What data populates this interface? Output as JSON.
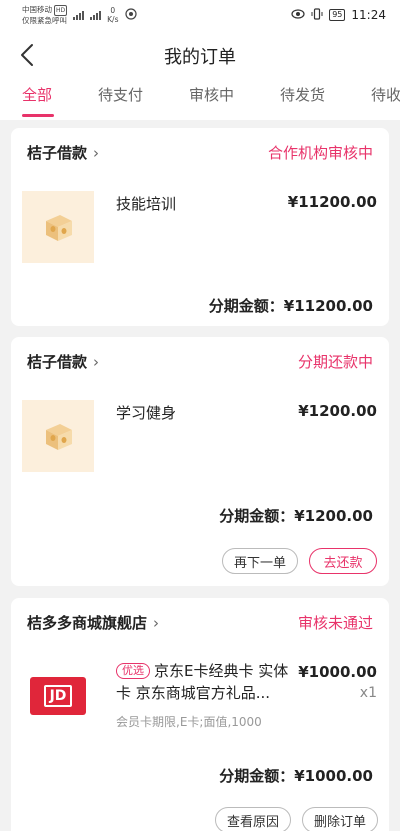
{
  "status_bar": {
    "carrier_line1": "中国移动",
    "carrier_line2": "仅限紧急呼叫",
    "network_badge": "HD",
    "speed_value": "0",
    "speed_unit": "K/s",
    "battery": "95",
    "time": "11:24"
  },
  "header": {
    "title": "我的订单"
  },
  "tabs": [
    {
      "label": "全部"
    },
    {
      "label": "待支付"
    },
    {
      "label": "审核中"
    },
    {
      "label": "待发货"
    },
    {
      "label": "待收"
    }
  ],
  "orders": [
    {
      "store": "桔子借款",
      "status": "合作机构审核中",
      "product": "技能培训",
      "price": "¥11200.00",
      "amount": "分期金额：¥11200.00",
      "buttons": []
    },
    {
      "store": "桔子借款",
      "status": "分期还款中",
      "product": "学习健身",
      "price": "¥1200.00",
      "amount": "分期金额：¥1200.00",
      "buttons": [
        "再下一单",
        "去还款"
      ]
    },
    {
      "store": "桔多多商城旗舰店",
      "status": "审核未通过",
      "tag": "优选",
      "product": "京东E卡经典卡 实体卡 京东商城官方礼品...",
      "spec": "会员卡期限,E卡;面值,1000",
      "price": "¥1000.00",
      "quantity": "x1",
      "amount": "分期金额：¥1000.00",
      "buttons": [
        "查看原因",
        "删除订单"
      ],
      "card_logo": "JD"
    }
  ],
  "colors": {
    "accent": "#e8336a",
    "background": "#f2f2f2"
  },
  "icons": [
    "back-arrow-icon",
    "chevron-right-icon",
    "coin-box-icon",
    "jd-card-icon",
    "eye-icon",
    "vibrate-icon",
    "battery-icon"
  ]
}
